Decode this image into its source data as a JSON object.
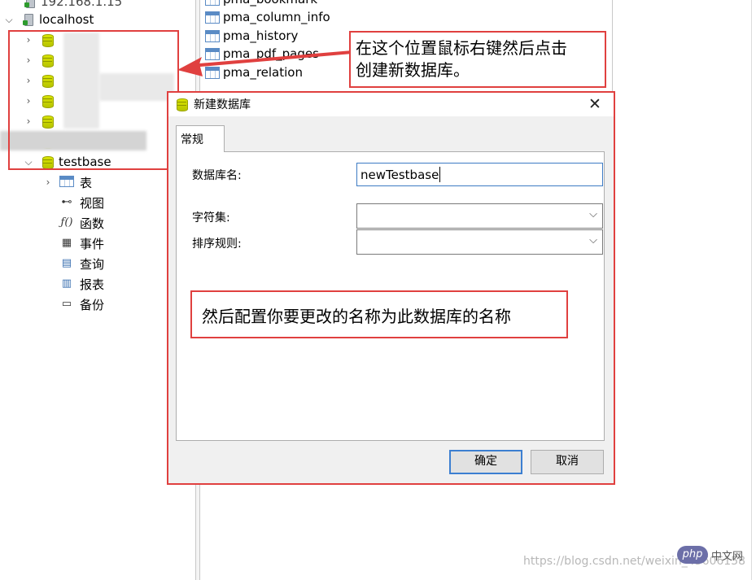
{
  "tree": {
    "top_item": "192.168.1.15",
    "host": "localhost",
    "testbase": "testbase",
    "children": [
      {
        "label": "表",
        "icon": "table-icon"
      },
      {
        "label": "视图",
        "icon": "view-icon"
      },
      {
        "label": "函数",
        "icon": "function-icon"
      },
      {
        "label": "事件",
        "icon": "event-icon"
      },
      {
        "label": "查询",
        "icon": "query-icon"
      },
      {
        "label": "报表",
        "icon": "report-icon"
      },
      {
        "label": "备份",
        "icon": "backup-icon"
      }
    ]
  },
  "tables": [
    "pma_bookmark",
    "pma_column_info",
    "pma_history",
    "pma_pdf_pages",
    "pma_relation"
  ],
  "callout_top": {
    "line1": "在这个位置鼠标右键然后点击",
    "line2": "创建新数据库。"
  },
  "callout_bottom": "然后配置你要更改的名称为此数据库的名称",
  "dialog": {
    "title": "新建数据库",
    "close_label": "✕",
    "tab": "常规",
    "db_name_label": "数据库名:",
    "db_name_value": "newTestbase",
    "charset_label": "字符集:",
    "charset_value": "",
    "collation_label": "排序规则:",
    "collation_value": "",
    "ok_label": "确定",
    "cancel_label": "取消"
  },
  "watermark": "https://blog.csdn.net/weixin_43606158",
  "php_badge": "php",
  "php_site": "中文网",
  "colors": {
    "annotation_red": "#e0403f",
    "focus_blue": "#3d7bc4",
    "db_icon_yellow": "#d8e300"
  }
}
